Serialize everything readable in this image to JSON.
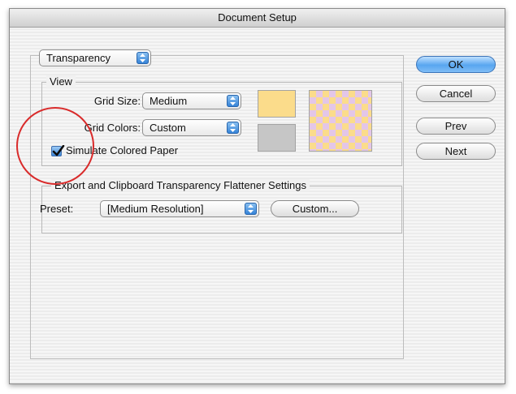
{
  "window": {
    "title": "Document Setup"
  },
  "category_popup": {
    "value": "Transparency"
  },
  "view_group": {
    "label": "View",
    "grid_size_label": "Grid Size:",
    "grid_size_value": "Medium",
    "grid_colors_label": "Grid Colors:",
    "grid_colors_value": "Custom",
    "simulate_label": "Simulate Colored Paper",
    "simulate_checked": true,
    "swatch_colors": {
      "light": "#fbdc8b",
      "dark": "#c6c6c6"
    }
  },
  "flattener_group": {
    "label": "Export and Clipboard Transparency Flattener Settings",
    "preset_label": "Preset:",
    "preset_value": "[Medium Resolution]",
    "custom_button": "Custom..."
  },
  "buttons": {
    "ok": "OK",
    "cancel": "Cancel",
    "prev": "Prev",
    "next": "Next"
  },
  "colors": {
    "accent": "#4a9be8",
    "annotation": "#d92b2b"
  }
}
